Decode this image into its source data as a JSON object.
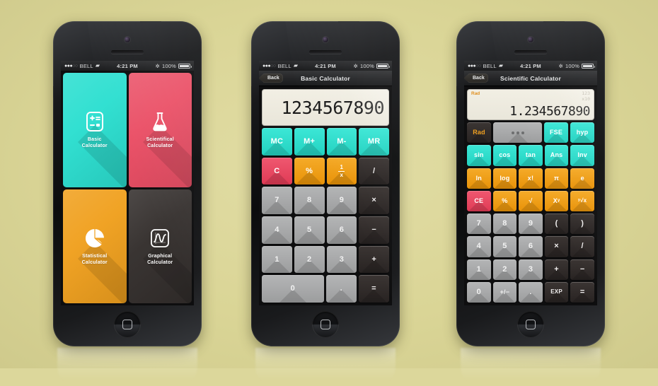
{
  "background_color": "#dcd79b",
  "status_bar": {
    "carrier": "BELL",
    "signal_dots_on": 3,
    "signal_dots_off": 2,
    "wifi_icon": "wifi-icon",
    "time": "4:21 PM",
    "bluetooth_icon": "bluetooth-icon",
    "battery_percent": "100%"
  },
  "phone1": {
    "screen_name": "home-grid",
    "tiles": [
      {
        "label_line1": "Basic",
        "label_line2": "Calculator",
        "color": "#2bdfd0",
        "icon": "calculator-icon"
      },
      {
        "label_line1": "Scientifical",
        "label_line2": "Calculator",
        "color": "#ea4c63",
        "icon": "flask-icon"
      },
      {
        "label_line1": "Statistical",
        "label_line2": "Calculator",
        "color": "#f0a01e",
        "icon": "pie-chart-icon"
      },
      {
        "label_line1": "Graphical",
        "label_line2": "Calculator",
        "color": "#332e2c",
        "icon": "graph-curve-icon"
      }
    ]
  },
  "phone2": {
    "nav": {
      "back_label": "Back",
      "title": "Basic Calculator"
    },
    "display_value": "1234567890",
    "keys": [
      [
        {
          "label": "MC",
          "style": "teal"
        },
        {
          "label": "M+",
          "style": "teal"
        },
        {
          "label": "M-",
          "style": "teal"
        },
        {
          "label": "MR",
          "style": "teal"
        }
      ],
      [
        {
          "label": "C",
          "style": "red"
        },
        {
          "label": "%",
          "style": "orange"
        },
        {
          "label": "1/x",
          "style": "orange",
          "glyph": "fraction-one-over-x"
        },
        {
          "label": "/",
          "style": "dark"
        }
      ],
      [
        {
          "label": "7",
          "style": "gray"
        },
        {
          "label": "8",
          "style": "gray"
        },
        {
          "label": "9",
          "style": "gray"
        },
        {
          "label": "×",
          "style": "dark"
        }
      ],
      [
        {
          "label": "4",
          "style": "gray"
        },
        {
          "label": "5",
          "style": "gray"
        },
        {
          "label": "6",
          "style": "gray"
        },
        {
          "label": "−",
          "style": "dark"
        }
      ],
      [
        {
          "label": "1",
          "style": "gray"
        },
        {
          "label": "2",
          "style": "gray"
        },
        {
          "label": "3",
          "style": "gray"
        },
        {
          "label": "+",
          "style": "dark"
        }
      ],
      [
        {
          "label": "0",
          "style": "gray",
          "wide": true
        },
        {
          "label": ".",
          "style": "gray"
        },
        {
          "label": "=",
          "style": "dark"
        }
      ]
    ]
  },
  "phone3": {
    "nav": {
      "back_label": "Back",
      "title": "Scientific Calculator"
    },
    "display": {
      "mode": "Rad",
      "exp_top": "123",
      "exp_bottom": "x10",
      "value": "1.234567890"
    },
    "keys": [
      [
        {
          "label": "Rad",
          "style": "dark-orange-text"
        },
        {
          "label": "•••",
          "style": "gray",
          "wide": true,
          "glyph": "three-dots"
        },
        {
          "label": "FSE",
          "style": "teal"
        },
        {
          "label": "hyp",
          "style": "teal"
        }
      ],
      [
        {
          "label": "sin",
          "style": "teal"
        },
        {
          "label": "cos",
          "style": "teal"
        },
        {
          "label": "tan",
          "style": "teal"
        },
        {
          "label": "Ans",
          "style": "teal"
        },
        {
          "label": "Inv",
          "style": "teal"
        }
      ],
      [
        {
          "label": "ln",
          "style": "orange"
        },
        {
          "label": "log",
          "style": "orange"
        },
        {
          "label": "x!",
          "style": "orange"
        },
        {
          "label": "π",
          "style": "orange"
        },
        {
          "label": "e",
          "style": "orange"
        }
      ],
      [
        {
          "label": "CE",
          "style": "red"
        },
        {
          "label": "%",
          "style": "orange"
        },
        {
          "label": "√",
          "style": "orange"
        },
        {
          "label": "Xʸ",
          "style": "orange"
        },
        {
          "label": "ʸ√x",
          "style": "orange"
        }
      ],
      [
        {
          "label": "7",
          "style": "gray"
        },
        {
          "label": "8",
          "style": "gray"
        },
        {
          "label": "9",
          "style": "gray"
        },
        {
          "label": "(",
          "style": "dark"
        },
        {
          "label": ")",
          "style": "dark"
        }
      ],
      [
        {
          "label": "4",
          "style": "gray"
        },
        {
          "label": "5",
          "style": "gray"
        },
        {
          "label": "6",
          "style": "gray"
        },
        {
          "label": "×",
          "style": "dark"
        },
        {
          "label": "/",
          "style": "dark"
        }
      ],
      [
        {
          "label": "1",
          "style": "gray"
        },
        {
          "label": "2",
          "style": "gray"
        },
        {
          "label": "3",
          "style": "gray"
        },
        {
          "label": "+",
          "style": "dark"
        },
        {
          "label": "−",
          "style": "dark"
        }
      ],
      [
        {
          "label": "0",
          "style": "gray"
        },
        {
          "label": "+/−",
          "style": "gray"
        },
        {
          "label": ".",
          "style": "gray"
        },
        {
          "label": "EXP",
          "style": "dark"
        },
        {
          "label": "=",
          "style": "dark"
        }
      ]
    ]
  }
}
